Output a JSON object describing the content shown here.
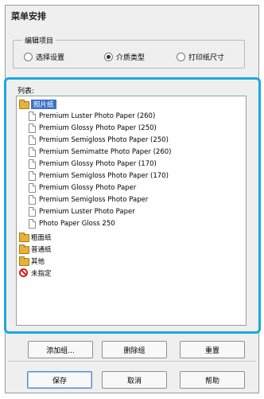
{
  "dialog": {
    "title": "菜单安排"
  },
  "edit_group": {
    "label": "编辑项目",
    "options": [
      {
        "label": "选择设置",
        "selected": false
      },
      {
        "label": "介质类型",
        "selected": true
      },
      {
        "label": "打印纸尺寸",
        "selected": false
      }
    ]
  },
  "list": {
    "label": "列表:",
    "items": [
      {
        "label": "照片纸",
        "icon": "folder-icon",
        "selected": true
      },
      {
        "label": "Premium Luster Photo Paper (260)",
        "icon": "page-icon"
      },
      {
        "label": "Premium Glossy Photo Paper (250)",
        "icon": "page-icon"
      },
      {
        "label": "Premium Semigloss Photo Paper (250)",
        "icon": "page-icon"
      },
      {
        "label": "Premium Semimatte Photo Paper (260)",
        "icon": "page-icon"
      },
      {
        "label": "Premium Glossy Photo Paper (170)",
        "icon": "page-icon"
      },
      {
        "label": "Premium Semigloss Photo Paper (170)",
        "icon": "page-icon"
      },
      {
        "label": "Premium Glossy Photo Paper",
        "icon": "page-icon"
      },
      {
        "label": "Premium Semigloss Photo Paper",
        "icon": "page-icon"
      },
      {
        "label": "Premium Luster Photo Paper",
        "icon": "page-icon"
      },
      {
        "label": "Photo Paper Gloss 250",
        "icon": "page-icon"
      },
      {
        "label": "粗面纸",
        "icon": "folder-icon"
      },
      {
        "label": "普通纸",
        "icon": "folder-icon"
      },
      {
        "label": "其他",
        "icon": "folder-icon"
      },
      {
        "label": "未指定",
        "icon": "no-entry-icon"
      }
    ]
  },
  "buttons": {
    "add_group": "添加组...",
    "delete_group": "删除组",
    "reset": "重置",
    "save": "保存",
    "cancel": "取消",
    "help": "帮助"
  },
  "colors": {
    "highlight": "#1aa9de",
    "selection": "#3f72c6"
  }
}
